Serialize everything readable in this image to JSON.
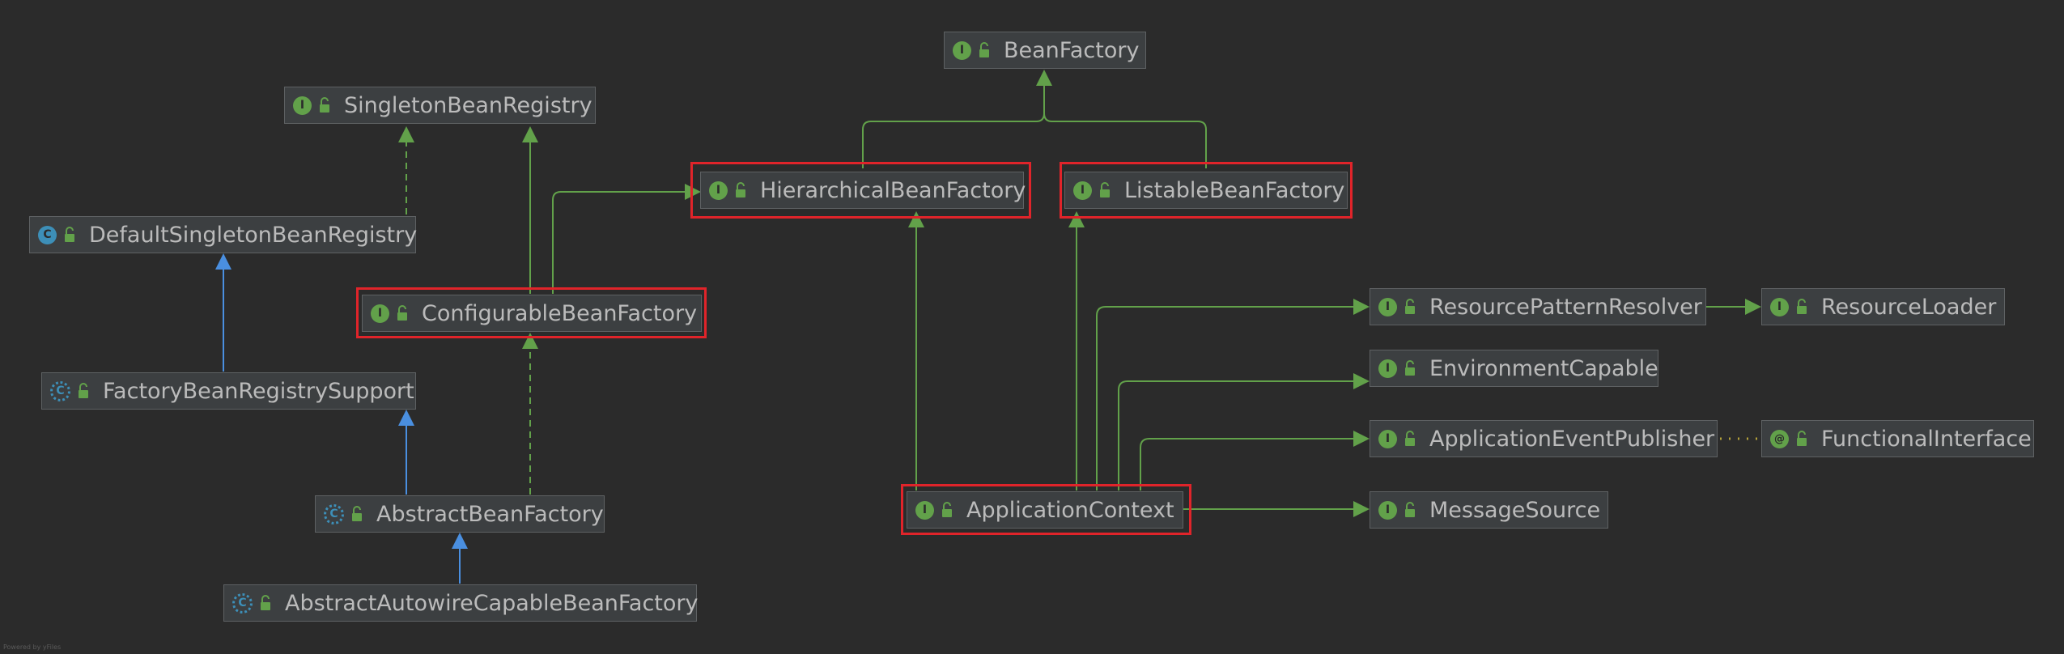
{
  "nodes": {
    "bean_factory": {
      "label": "BeanFactory",
      "kind": "interface",
      "badge": "I"
    },
    "singleton_bean_registry": {
      "label": "SingletonBeanRegistry",
      "kind": "interface",
      "badge": "I"
    },
    "hierarchical_bean_factory": {
      "label": "HierarchicalBeanFactory",
      "kind": "interface",
      "badge": "I"
    },
    "listable_bean_factory": {
      "label": "ListableBeanFactory",
      "kind": "interface",
      "badge": "I"
    },
    "default_singleton_bean_registry": {
      "label": "DefaultSingletonBeanRegistry",
      "kind": "class",
      "badge": "C"
    },
    "configurable_bean_factory": {
      "label": "ConfigurableBeanFactory",
      "kind": "interface",
      "badge": "I"
    },
    "factory_bean_registry_support": {
      "label": "FactoryBeanRegistrySupport",
      "kind": "abstract-class",
      "badge": "C"
    },
    "abstract_bean_factory": {
      "label": "AbstractBeanFactory",
      "kind": "abstract-class",
      "badge": "C"
    },
    "abstract_autowire_capable_bean_factory": {
      "label": "AbstractAutowireCapableBeanFactory",
      "kind": "abstract-class",
      "badge": "C"
    },
    "application_context": {
      "label": "ApplicationContext",
      "kind": "interface",
      "badge": "I"
    },
    "resource_pattern_resolver": {
      "label": "ResourcePatternResolver",
      "kind": "interface",
      "badge": "I"
    },
    "resource_loader": {
      "label": "ResourceLoader",
      "kind": "interface",
      "badge": "I"
    },
    "environment_capable": {
      "label": "EnvironmentCapable",
      "kind": "interface",
      "badge": "I"
    },
    "application_event_publisher": {
      "label": "ApplicationEventPublisher",
      "kind": "interface",
      "badge": "I"
    },
    "functional_interface": {
      "label": "FunctionalInterface",
      "kind": "annotation",
      "badge": "@"
    },
    "message_source": {
      "label": "MessageSource",
      "kind": "interface",
      "badge": "I"
    }
  },
  "edges": [
    {
      "from": "hierarchical_bean_factory",
      "to": "bean_factory",
      "type": "interface-extends"
    },
    {
      "from": "listable_bean_factory",
      "to": "bean_factory",
      "type": "interface-extends"
    },
    {
      "from": "default_singleton_bean_registry",
      "to": "singleton_bean_registry",
      "type": "implements"
    },
    {
      "from": "configurable_bean_factory",
      "to": "singleton_bean_registry",
      "type": "interface-extends"
    },
    {
      "from": "configurable_bean_factory",
      "to": "hierarchical_bean_factory",
      "type": "interface-extends"
    },
    {
      "from": "factory_bean_registry_support",
      "to": "default_singleton_bean_registry",
      "type": "extends"
    },
    {
      "from": "abstract_bean_factory",
      "to": "factory_bean_registry_support",
      "type": "extends"
    },
    {
      "from": "abstract_bean_factory",
      "to": "configurable_bean_factory",
      "type": "implements"
    },
    {
      "from": "abstract_autowire_capable_bean_factory",
      "to": "abstract_bean_factory",
      "type": "extends"
    },
    {
      "from": "application_context",
      "to": "hierarchical_bean_factory",
      "type": "interface-extends"
    },
    {
      "from": "application_context",
      "to": "listable_bean_factory",
      "type": "interface-extends"
    },
    {
      "from": "application_context",
      "to": "resource_pattern_resolver",
      "type": "interface-extends"
    },
    {
      "from": "application_context",
      "to": "environment_capable",
      "type": "interface-extends"
    },
    {
      "from": "application_context",
      "to": "application_event_publisher",
      "type": "interface-extends"
    },
    {
      "from": "application_context",
      "to": "message_source",
      "type": "interface-extends"
    },
    {
      "from": "resource_pattern_resolver",
      "to": "resource_loader",
      "type": "interface-extends"
    },
    {
      "from": "application_event_publisher",
      "to": "functional_interface",
      "type": "annotated-by"
    }
  ],
  "highlighted": [
    "hierarchical_bean_factory",
    "listable_bean_factory",
    "configurable_bean_factory",
    "application_context"
  ],
  "colors": {
    "background": "#2b2b2b",
    "node_fill": "#3c3f41",
    "node_border": "#5e6163",
    "interface_arrow": "#62a14a",
    "class_arrow": "#4a8fe0",
    "highlight": "#e0242a",
    "annotation_link": "#b5a23a",
    "text": "#bbbbbb"
  },
  "footer": {
    "text": "Powered by yFiles"
  }
}
